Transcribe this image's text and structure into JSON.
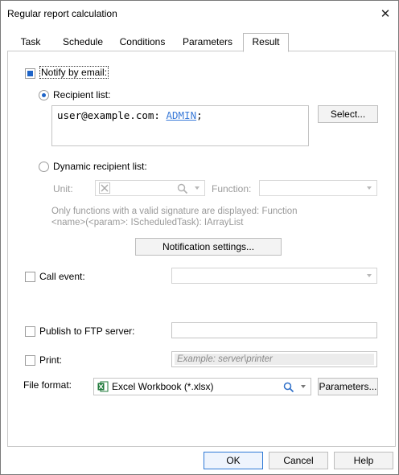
{
  "window": {
    "title": "Regular report calculation"
  },
  "tabs": [
    {
      "label": "Task"
    },
    {
      "label": "Schedule"
    },
    {
      "label": "Conditions"
    },
    {
      "label": "Parameters"
    },
    {
      "label": "Result"
    }
  ],
  "notify": {
    "label": "Notify by email:",
    "checked": true,
    "recipient_list_label": "Recipient list:",
    "recipient_email": "user@example.com:",
    "recipient_name": "ADMIN",
    "recipient_suffix": ";",
    "select_button": "Select...",
    "dynamic_list_label": "Dynamic recipient list:",
    "unit_label": "Unit:",
    "function_label": "Function:",
    "hint_line1": "Only functions with a valid signature are displayed: Function",
    "hint_line2": "<name>(<param>: IScheduledTask): IArrayList",
    "notification_settings_button": "Notification settings..."
  },
  "call_event": {
    "label": "Call event:",
    "value": ""
  },
  "ftp": {
    "label": "Publish to FTP server:",
    "value": ""
  },
  "print": {
    "label": "Print:",
    "placeholder": "Example: server\\printer"
  },
  "file_format": {
    "label": "File format:",
    "value": "Excel Workbook (*.xlsx)",
    "parameters_button": "Parameters..."
  },
  "footer": {
    "ok": "OK",
    "cancel": "Cancel",
    "help": "Help"
  },
  "colors": {
    "accent": "#1e64c8",
    "link": "#3a7ad8",
    "excel_green": "#1f7a3a"
  }
}
